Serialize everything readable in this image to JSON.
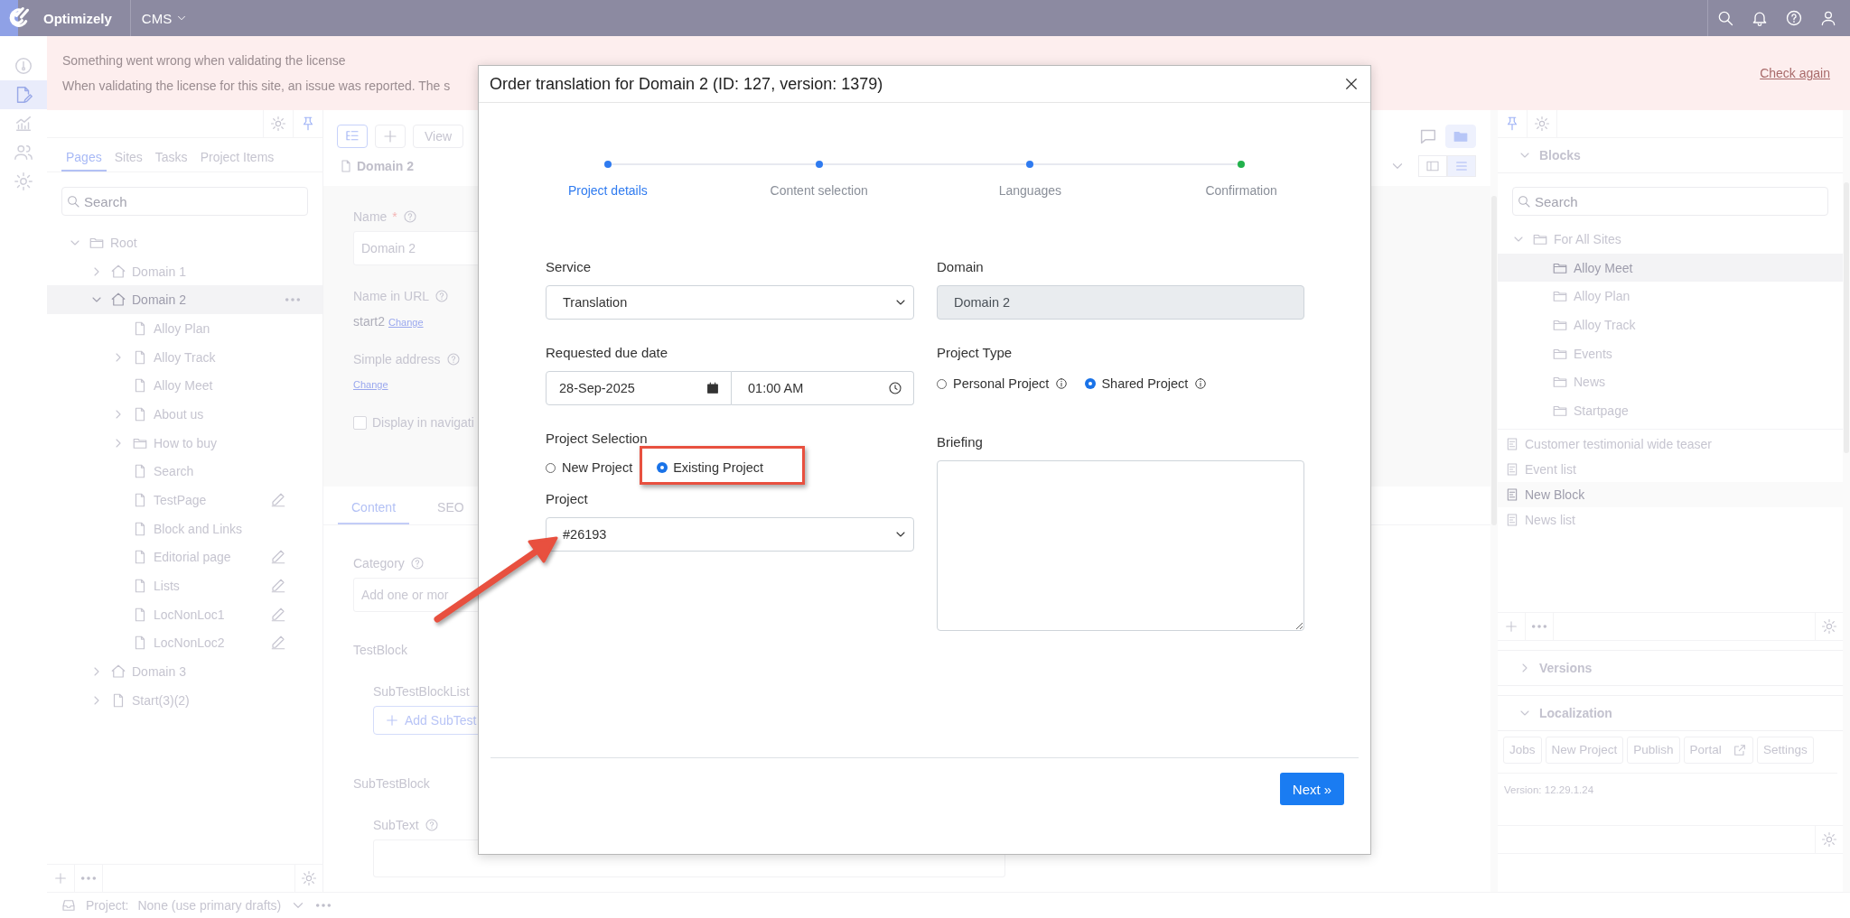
{
  "top_bar": {
    "brand": "Optimizely",
    "product": "CMS"
  },
  "banner": {
    "title": "Something went wrong when validating the license",
    "message": "When validating the license for this site, an issue was reported. The s",
    "link": "Check again"
  },
  "rail": [
    {
      "kind": "dashboard",
      "selected": false
    },
    {
      "kind": "edit",
      "selected": true
    },
    {
      "kind": "reports",
      "selected": false
    },
    {
      "kind": "users",
      "selected": false
    },
    {
      "kind": "settings",
      "selected": false
    }
  ],
  "left_panel": {
    "tabs": [
      {
        "label": "Pages",
        "selected": true
      },
      {
        "label": "Sites",
        "selected": false
      },
      {
        "label": "Tasks",
        "selected": false
      },
      {
        "label": "Project Items",
        "selected": false
      }
    ],
    "search": {
      "placeholder": "Search"
    },
    "tree": [
      {
        "label": "Root",
        "kind": "folder",
        "expanded": true,
        "selected": false,
        "draft": false,
        "children": [
          {
            "label": "Domain 1",
            "kind": "home",
            "expanded": false,
            "selected": false,
            "draft": false
          },
          {
            "label": "Domain 2",
            "kind": "home",
            "expanded": true,
            "selected": true,
            "draft": false,
            "children": [
              {
                "label": "Alloy Plan",
                "kind": "page",
                "selected": false,
                "draft": false
              },
              {
                "label": "Alloy Track",
                "kind": "page",
                "expanded": false,
                "selected": false,
                "draft": false
              },
              {
                "label": "Alloy Meet",
                "kind": "page",
                "selected": false,
                "draft": false
              },
              {
                "label": "About us",
                "kind": "page",
                "expanded": false,
                "selected": false,
                "draft": false
              },
              {
                "label": "How to buy",
                "kind": "folder",
                "expanded": false,
                "selected": false,
                "draft": false
              },
              {
                "label": "Search",
                "kind": "page",
                "selected": false,
                "draft": false
              },
              {
                "label": "TestPage",
                "kind": "page",
                "selected": false,
                "draft": true
              },
              {
                "label": "Block and Links",
                "kind": "page",
                "selected": false,
                "draft": false
              },
              {
                "label": "Editorial page",
                "kind": "page",
                "selected": false,
                "draft": true
              },
              {
                "label": "Lists",
                "kind": "page",
                "selected": false,
                "draft": true
              },
              {
                "label": "LocNonLoc1",
                "kind": "page",
                "selected": false,
                "draft": true
              },
              {
                "label": "LocNonLoc2",
                "kind": "page",
                "selected": false,
                "draft": true
              }
            ]
          },
          {
            "label": "Domain 3",
            "kind": "home",
            "expanded": false,
            "selected": false,
            "draft": false
          },
          {
            "label": "Start(3)(2)",
            "kind": "page",
            "expanded": false,
            "selected": false,
            "draft": false
          }
        ]
      }
    ]
  },
  "editor": {
    "view_button": "View",
    "title": "Domain 2",
    "name_label": "Name",
    "required_mark": "*",
    "name_value": "Domain 2",
    "url_label": "Name in URL",
    "url_value": "start2",
    "url_link": "Change",
    "address_label": "Simple address",
    "address_link": "Change",
    "nav_checkbox": {
      "label": "Display in navigati",
      "checked": false
    },
    "tabs": [
      {
        "label": "Content",
        "selected": true
      },
      {
        "label": "SEO",
        "selected": false
      }
    ],
    "category_label": "Category",
    "category_placeholder": "Add one or mor",
    "block_label": "TestBlock",
    "list_label": "SubTestBlockList",
    "add_button": "Add SubTest",
    "sub_block_label": "SubTestBlock",
    "subtext_label": "SubText"
  },
  "right_panel": {
    "blocks": {
      "title": "Blocks",
      "expanded": true,
      "search_placeholder": "Search",
      "tree": [
        {
          "label": "For All Sites",
          "expanded": true,
          "selected": false,
          "children": [
            {
              "label": "Alloy Meet",
              "selected": true
            },
            {
              "label": "Alloy Plan",
              "selected": false
            },
            {
              "label": "Alloy Track",
              "selected": false
            },
            {
              "label": "Events",
              "selected": false
            },
            {
              "label": "News",
              "selected": false
            },
            {
              "label": "Startpage",
              "selected": false
            }
          ]
        }
      ],
      "items": [
        {
          "label": "Customer testimonial wide teaser",
          "selected": false
        },
        {
          "label": "Event list",
          "selected": false
        },
        {
          "label": "New Block",
          "selected": true
        },
        {
          "label": "News list",
          "selected": false
        }
      ]
    },
    "versions": {
      "title": "Versions",
      "expanded": false
    },
    "localization": {
      "title": "Localization",
      "expanded": true,
      "buttons": [
        {
          "label": "Jobs",
          "kind": "plain"
        },
        {
          "label": "New Project",
          "kind": "plain"
        },
        {
          "label": "Publish",
          "kind": "plain"
        },
        {
          "label": "Portal",
          "kind": "external"
        },
        {
          "label": "Settings",
          "kind": "plain"
        }
      ],
      "version": "Version: 12.29.1.24"
    }
  },
  "status_bar": {
    "label": "Project:",
    "value": "None (use primary drafts)"
  },
  "dialog": {
    "title": "Order translation for Domain 2 (ID: 127, version: 1379)",
    "steps": [
      {
        "label": "Project details",
        "selected": true,
        "color": "#2f7bf0"
      },
      {
        "label": "Content selection",
        "selected": false,
        "color": "#2f7bf0"
      },
      {
        "label": "Languages",
        "selected": false,
        "color": "#2f7bf0"
      },
      {
        "label": "Confirmation",
        "selected": false,
        "color": "#22b14c"
      }
    ],
    "service": {
      "label": "Service",
      "value": "Translation"
    },
    "domain": {
      "label": "Domain",
      "value": "Domain 2",
      "disabled": true
    },
    "due_date": {
      "label": "Requested due date",
      "date": "28-Sep-2025",
      "time": "01:00 AM"
    },
    "project_type": {
      "label": "Project Type",
      "options": [
        {
          "label": "Personal Project",
          "selected": false
        },
        {
          "label": "Shared Project",
          "selected": true
        }
      ]
    },
    "project_selection": {
      "label": "Project Selection",
      "options": [
        {
          "label": "New Project",
          "selected": false
        },
        {
          "label": "Existing Project",
          "selected": true
        }
      ]
    },
    "briefing": {
      "label": "Briefing"
    },
    "project": {
      "label": "Project",
      "value": "#26193"
    },
    "next_button": "Next »"
  }
}
